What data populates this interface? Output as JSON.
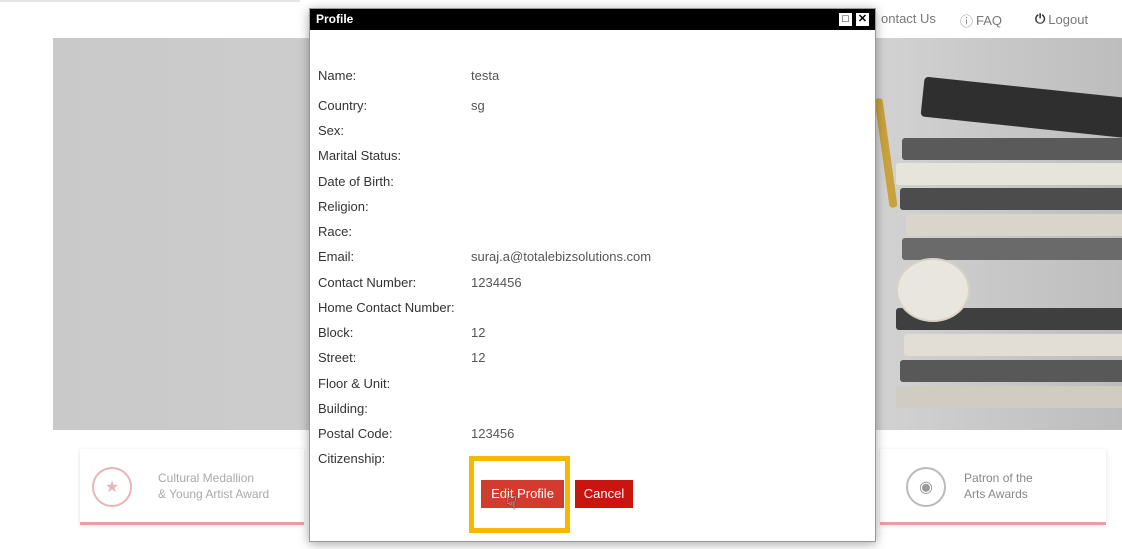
{
  "nav": {
    "contact": "ontact Us",
    "faq": "FAQ",
    "logout": "Logout",
    "icons": {
      "faq": "question-circle-icon",
      "logout": "power-icon"
    }
  },
  "awards": {
    "left": {
      "line1": "Cultural Medallion",
      "line2": "& Young Artist Award",
      "icon": "medallion-icon"
    },
    "right": {
      "line1": "Patron of the",
      "line2": "Arts Awards",
      "icon": "trophy-icon"
    }
  },
  "modal": {
    "title": "Profile",
    "fields": [
      {
        "label": "Name:",
        "value": "testa"
      },
      {
        "label": "Country:",
        "value": "sg"
      },
      {
        "label": "Sex:",
        "value": ""
      },
      {
        "label": "Marital Status:",
        "value": ""
      },
      {
        "label": "Date of Birth:",
        "value": ""
      },
      {
        "label": "Religion:",
        "value": ""
      },
      {
        "label": "Race:",
        "value": ""
      },
      {
        "label": "Email:",
        "value": "suraj.a@totalebizsolutions.com"
      },
      {
        "label": "Contact Number:",
        "value": "1234456"
      },
      {
        "label": "Home Contact Number:",
        "value": ""
      },
      {
        "label": "Block:",
        "value": "12"
      },
      {
        "label": "Street:",
        "value": "12"
      },
      {
        "label": "Floor & Unit:",
        "value": ""
      },
      {
        "label": "Building:",
        "value": ""
      },
      {
        "label": "Postal Code:",
        "value": "123456"
      },
      {
        "label": "Citizenship:",
        "value": ""
      }
    ],
    "edit_label": "Edit Profile",
    "cancel_label": "Cancel"
  },
  "colors": {
    "edit_button": "#d23b2e",
    "cancel_button": "#c9140f",
    "highlight": "#f5b700",
    "title_bar": "#000000"
  }
}
